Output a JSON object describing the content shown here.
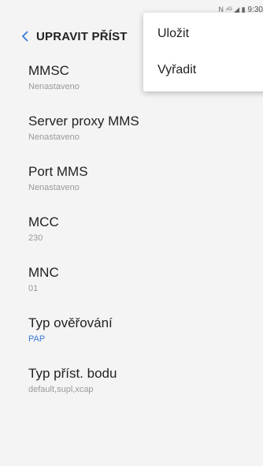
{
  "status_bar": {
    "icons": "N ⁴ᴳ ◢ ▮",
    "time": "9:30"
  },
  "app_bar": {
    "title": "UPRAVIT PŘÍST"
  },
  "menu": {
    "items": [
      {
        "label": "Uložit"
      },
      {
        "label": "Vyřadit"
      }
    ]
  },
  "settings": [
    {
      "title": "MMSC",
      "value": "Nenastaveno"
    },
    {
      "title": "Server proxy MMS",
      "value": "Nenastaveno"
    },
    {
      "title": "Port MMS",
      "value": "Nenastaveno"
    },
    {
      "title": "MCC",
      "value": "230"
    },
    {
      "title": "MNC",
      "value": "01"
    },
    {
      "title": "Typ ověřování",
      "value": "PAP"
    },
    {
      "title": "Typ příst. bodu",
      "value": "default,supl,xcap"
    }
  ],
  "colors": {
    "accent": "#3a7bd5",
    "background": "#f4f4f4"
  }
}
